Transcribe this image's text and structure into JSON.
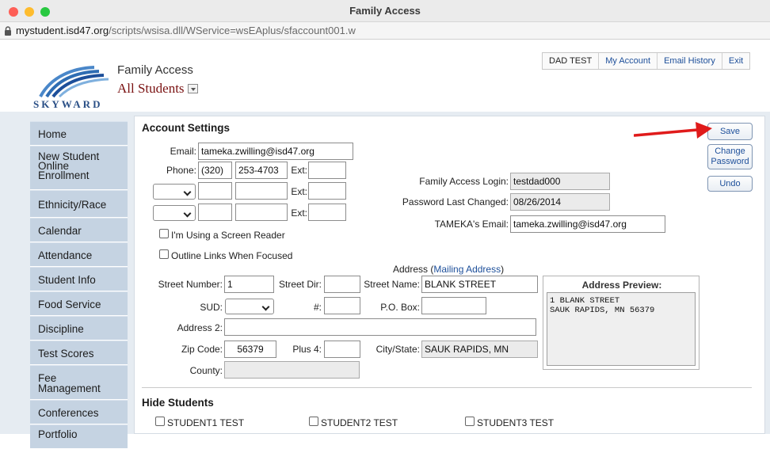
{
  "window": {
    "title": "Family Access"
  },
  "address_bar": {
    "host": "mystudent.isd47.org",
    "path": "/scripts/wsisa.dll/WService=wsEAplus/sfaccount001.w"
  },
  "header": {
    "logo_text": "SKYWARD",
    "app_name": "Family Access",
    "student_select": "All Students",
    "user_name": "DAD TEST",
    "links": {
      "my_account": "My Account",
      "email_history": "Email History",
      "exit": "Exit"
    }
  },
  "sidebar": {
    "items": [
      {
        "label": "Home"
      },
      {
        "label": "New Student\nOnline\nEnrollment"
      },
      {
        "label": "Ethnicity/Race"
      },
      {
        "label": "Calendar"
      },
      {
        "label": "Attendance"
      },
      {
        "label": "Student Info"
      },
      {
        "label": "Food Service"
      },
      {
        "label": "Discipline"
      },
      {
        "label": "Test Scores"
      },
      {
        "label": "Fee\nManagement"
      },
      {
        "label": "Conferences"
      },
      {
        "label": "Portfolio"
      }
    ]
  },
  "account": {
    "title": "Account Settings",
    "email_label": "Email:",
    "email_value": "tameka.zwilling@isd47.org",
    "phone_label": "Phone:",
    "phone_area": "(320)",
    "phone_number": "253-4703",
    "ext_label": "Ext:",
    "ext_value": "",
    "phone2_type": "",
    "phone2_area": "",
    "phone2_number": "",
    "phone2_ext": "",
    "phone3_type": "",
    "phone3_area": "",
    "phone3_number": "",
    "phone3_ext": "",
    "screen_reader_label": "I'm Using a Screen Reader",
    "outline_links_label": "Outline Links When Focused",
    "login_label": "Family Access Login:",
    "login_value": "testdad000",
    "pw_changed_label": "Password Last Changed:",
    "pw_changed_value": "08/26/2014",
    "student_email_label": "TAMEKA's Email:",
    "student_email_value": "tameka.zwilling@isd47.org"
  },
  "buttons": {
    "save": "Save",
    "change_password": "Change\nPassword",
    "undo": "Undo"
  },
  "address": {
    "heading": "Address",
    "mailing_link": "Mailing Address",
    "street_number_label": "Street Number:",
    "street_number": "1",
    "street_dir_label": "Street Dir:",
    "street_dir": "",
    "street_name_label": "Street Name:",
    "street_name": "BLANK STREET",
    "sud_label": "SUD:",
    "sud_value": "",
    "num_label": "#:",
    "num_value": "",
    "po_box_label": "P.O. Box:",
    "po_box": "",
    "address2_label": "Address 2:",
    "address2": "",
    "zip_label": "Zip Code:",
    "zip": "56379",
    "plus4_label": "Plus 4:",
    "plus4": "",
    "city_state_label": "City/State:",
    "city_state": "SAUK RAPIDS, MN",
    "county_label": "County:",
    "county": "",
    "preview_title": "Address Preview:",
    "preview_text": "1 BLANK STREET\nSAUK RAPIDS, MN 56379"
  },
  "hide_students": {
    "title": "Hide Students",
    "students": [
      "STUDENT1 TEST",
      "STUDENT2 TEST",
      "STUDENT3 TEST"
    ]
  },
  "colors": {
    "arrow": "#e01b1b",
    "link": "#1d4f9a",
    "nav_bg": "#c5d3e2"
  }
}
